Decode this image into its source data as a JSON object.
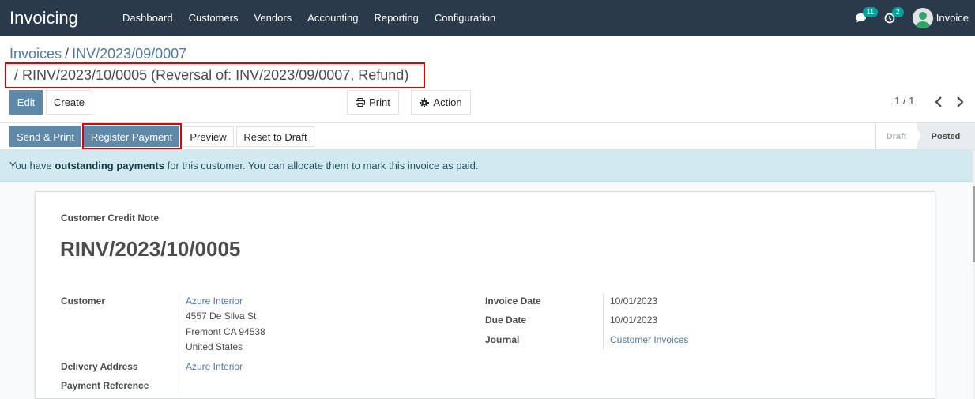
{
  "navbar": {
    "app_name": "Invoicing",
    "menu": [
      "Dashboard",
      "Customers",
      "Vendors",
      "Accounting",
      "Reporting",
      "Configuration"
    ],
    "messages_count": "11",
    "activities_count": "2",
    "user_name": "Invoice"
  },
  "breadcrumb": {
    "parent": "Invoices",
    "separator": "/",
    "parent_record": "INV/2023/09/0007",
    "current": "/ RINV/2023/10/0005 (Reversal of: INV/2023/09/0007, Refund)"
  },
  "buttons": {
    "edit": "Edit",
    "create": "Create",
    "print": "Print",
    "action": "Action"
  },
  "pager": {
    "value": "1 / 1"
  },
  "statusbar": {
    "send_print": "Send & Print",
    "register_payment": "Register Payment",
    "preview": "Preview",
    "reset_to_draft": "Reset to Draft",
    "stages": [
      "Draft",
      "Posted"
    ],
    "active_stage": "Posted"
  },
  "alert": {
    "prefix": "You have ",
    "bold": "outstanding payments",
    "suffix": " for this customer. You can allocate them to mark this invoice as paid."
  },
  "sheet": {
    "doc_type": "Customer Credit Note",
    "doc_name": "RINV/2023/10/0005",
    "customer_label": "Customer",
    "customer_name": "Azure Interior",
    "customer_address": [
      "4557 De Silva St",
      "Fremont CA 94538",
      "United States"
    ],
    "delivery_label": "Delivery Address",
    "delivery_value": "Azure Interior",
    "payment_ref_label": "Payment Reference",
    "invoice_date_label": "Invoice Date",
    "invoice_date": "10/01/2023",
    "due_date_label": "Due Date",
    "due_date": "10/01/2023",
    "journal_label": "Journal",
    "journal": "Customer Invoices"
  },
  "colors": {
    "navbar": "#2b3a4a",
    "primary": "#5e8aa8",
    "link": "#4f7a9b",
    "highlight": "#e00000",
    "alert_bg": "#d2eaef",
    "badge": "#00a09d"
  }
}
